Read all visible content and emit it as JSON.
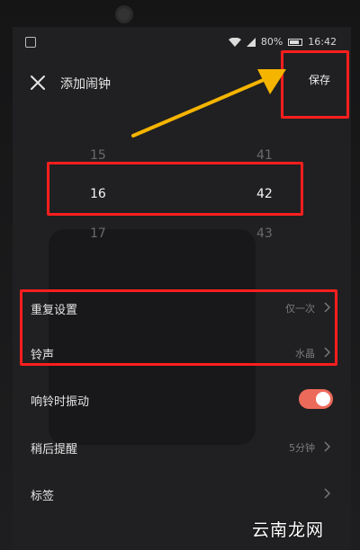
{
  "status_bar": {
    "battery": "80%",
    "time": "16:42"
  },
  "header": {
    "title": "添加闹钟",
    "save_label": "保存"
  },
  "picker": {
    "hours": {
      "prev": "15",
      "selected": "16",
      "next": "17"
    },
    "minutes": {
      "prev": "41",
      "selected": "42",
      "next": "43"
    }
  },
  "settings": {
    "repeat": {
      "label": "重复设置",
      "value": "仅一次"
    },
    "ringtone": {
      "label": "铃声",
      "value": "水晶"
    },
    "vibrate": {
      "label": "响铃时振动",
      "on": true
    },
    "snooze": {
      "label": "稍后提醒",
      "value": "5分钟"
    },
    "tag": {
      "label": "标签",
      "value": ""
    }
  },
  "watermark": "云南龙网",
  "colors": {
    "accent": "#ec6a5a",
    "highlight": "#ff1e1e",
    "arrow": "#f5b400"
  },
  "icons": [
    "close-icon",
    "chevron-right-icon",
    "wifi-icon",
    "signal-icon",
    "battery-icon"
  ]
}
